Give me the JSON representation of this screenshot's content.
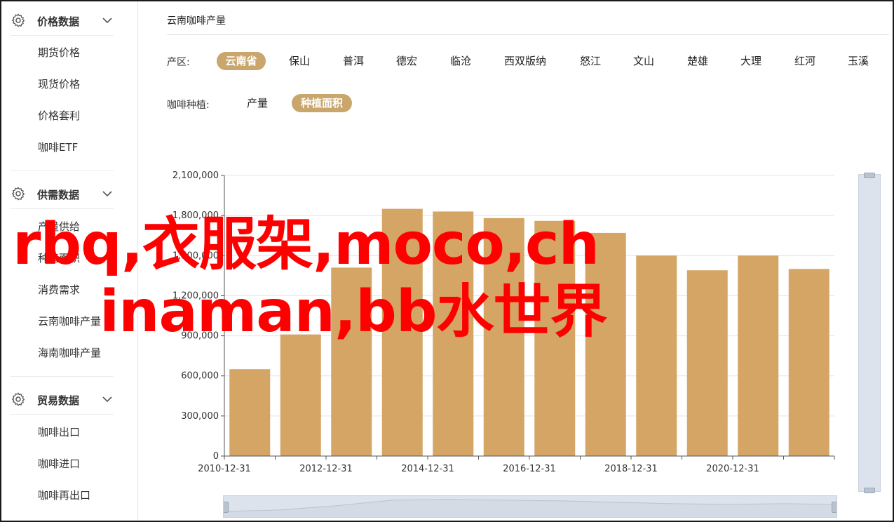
{
  "sidebar": {
    "sections": [
      {
        "title": "价格数据",
        "items": [
          "期货价格",
          "现货价格",
          "价格套利",
          "咖啡ETF"
        ]
      },
      {
        "title": "供需数据",
        "items": [
          "产量供给",
          "种植面积",
          "消费需求",
          "云南咖啡产量",
          "海南咖啡产量"
        ]
      },
      {
        "title": "贸易数据",
        "items": [
          "咖啡出口",
          "咖啡进口",
          "咖啡再出口"
        ]
      }
    ]
  },
  "page": {
    "title": "云南咖啡产量"
  },
  "filters": {
    "region_label": "产区:",
    "regions": [
      "云南省",
      "保山",
      "普洱",
      "德宏",
      "临沧",
      "西双版纳",
      "怒江",
      "文山",
      "楚雄",
      "大理",
      "红河",
      "玉溪"
    ],
    "region_active": 0,
    "type_label": "咖啡种植:",
    "types": [
      "产量",
      "种植面积"
    ],
    "type_active": 1
  },
  "overlay": {
    "line1": "rbq,衣服架,moco,ch",
    "line2": "inaman,bb水世界"
  },
  "colors": {
    "accent": "#c9a66b",
    "bar": "#d4a565",
    "overlay": "#ff0000"
  },
  "chart_data": {
    "type": "bar",
    "categories": [
      "2010-12-31",
      "2011-12-31",
      "2012-12-31",
      "2013-12-31",
      "2014-12-31",
      "2015-12-31",
      "2016-12-31",
      "2017-12-31",
      "2018-12-31",
      "2019-12-31",
      "2020-12-31",
      "2021-12-31"
    ],
    "x_tick_labels": [
      "2010-12-31",
      "2012-12-31",
      "2014-12-31",
      "2016-12-31",
      "2018-12-31",
      "2020-12-31"
    ],
    "values": [
      650000,
      910000,
      1410000,
      1850000,
      1830000,
      1780000,
      1760000,
      1670000,
      1500000,
      1390000,
      1500000,
      1400000
    ],
    "y_ticks": [
      "0",
      "300,000",
      "600,000",
      "900,000",
      "1,200,000",
      "1,500,000",
      "1,800,000",
      "2,100,000"
    ],
    "ylim": [
      0,
      2100000
    ],
    "grid": true,
    "title": "",
    "xlabel": "",
    "ylabel": ""
  }
}
